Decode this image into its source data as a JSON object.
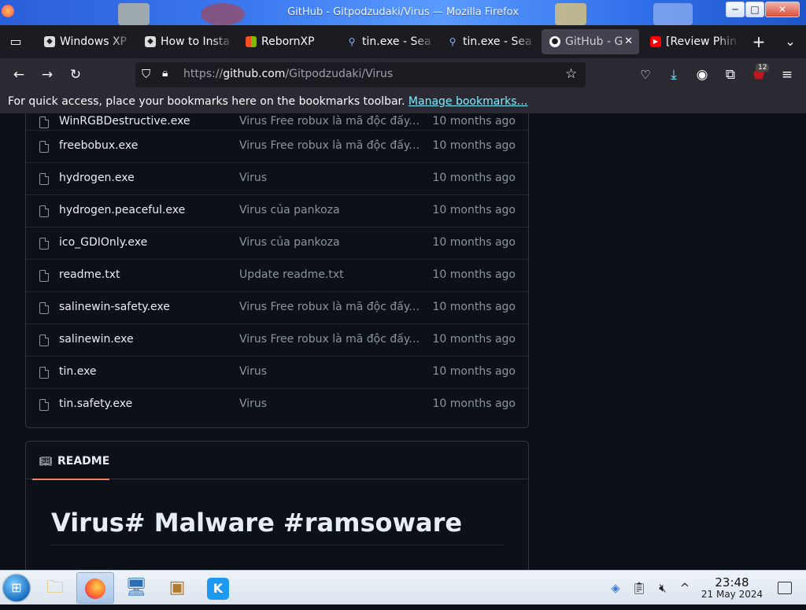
{
  "window": {
    "title": "GitHub - Gitpodzudaki/Virus — Mozilla Firefox",
    "minimize_glyph": "─",
    "maximize_glyph": "□",
    "close_glyph": "✕"
  },
  "tabs": [
    {
      "label": "Windows XP",
      "icon": "roblox-icon",
      "active": false
    },
    {
      "label": "How to Insta",
      "icon": "roblox-icon",
      "active": false
    },
    {
      "label": "RebornXP",
      "icon": "windows-flag-icon",
      "active": false
    },
    {
      "label": "tin.exe - Sea",
      "icon": "search-icon",
      "active": false
    },
    {
      "label": "tin.exe - Sea",
      "icon": "search-icon",
      "active": false
    },
    {
      "label": "GitHub - G",
      "icon": "github-icon",
      "active": true
    },
    {
      "label": "[Review Phin",
      "icon": "youtube-icon",
      "active": false
    }
  ],
  "nav": {
    "url_prefix": "https://",
    "url_host": "github.com",
    "url_path": "/Gitpodzudaki/Virus",
    "extensions_badge": "12"
  },
  "bookmarks_bar": {
    "message": "For quick access, place your bookmarks here on the bookmarks toolbar.",
    "link": "Manage bookmarks…"
  },
  "files": [
    {
      "name": "WinRGBDestructive.exe",
      "commit": "Virus Free robux là mã độc đấy.Đừng tải về",
      "age": "10 months ago"
    },
    {
      "name": "freebobux.exe",
      "commit": "Virus Free robux là mã độc đấy.Đừng tải về",
      "age": "10 months ago"
    },
    {
      "name": "hydrogen.exe",
      "commit": "Virus",
      "age": "10 months ago"
    },
    {
      "name": "hydrogen.peaceful.exe",
      "commit": "Virus của pankoza",
      "age": "10 months ago"
    },
    {
      "name": "ico_GDIOnly.exe",
      "commit": "Virus của pankoza",
      "age": "10 months ago"
    },
    {
      "name": "readme.txt",
      "commit": "Update readme.txt",
      "age": "10 months ago"
    },
    {
      "name": "salinewin-safety.exe",
      "commit": "Virus Free robux là mã độc đấy.Đừng tải về",
      "age": "10 months ago"
    },
    {
      "name": "salinewin.exe",
      "commit": "Virus Free robux là mã độc đấy.Đừng tải về",
      "age": "10 months ago"
    },
    {
      "name": "tin.exe",
      "commit": "Virus",
      "age": "10 months ago"
    },
    {
      "name": "tin.safety.exe",
      "commit": "Virus",
      "age": "10 months ago"
    }
  ],
  "readme": {
    "tab_label": "README",
    "heading": "Virus# Malware #ramsoware"
  },
  "taskbar": {
    "time": "23:48",
    "date": "21 May 2024"
  },
  "colors": {
    "accent_underline": "#f78166",
    "link": "#80ebff",
    "github_bg": "#0d1117"
  }
}
